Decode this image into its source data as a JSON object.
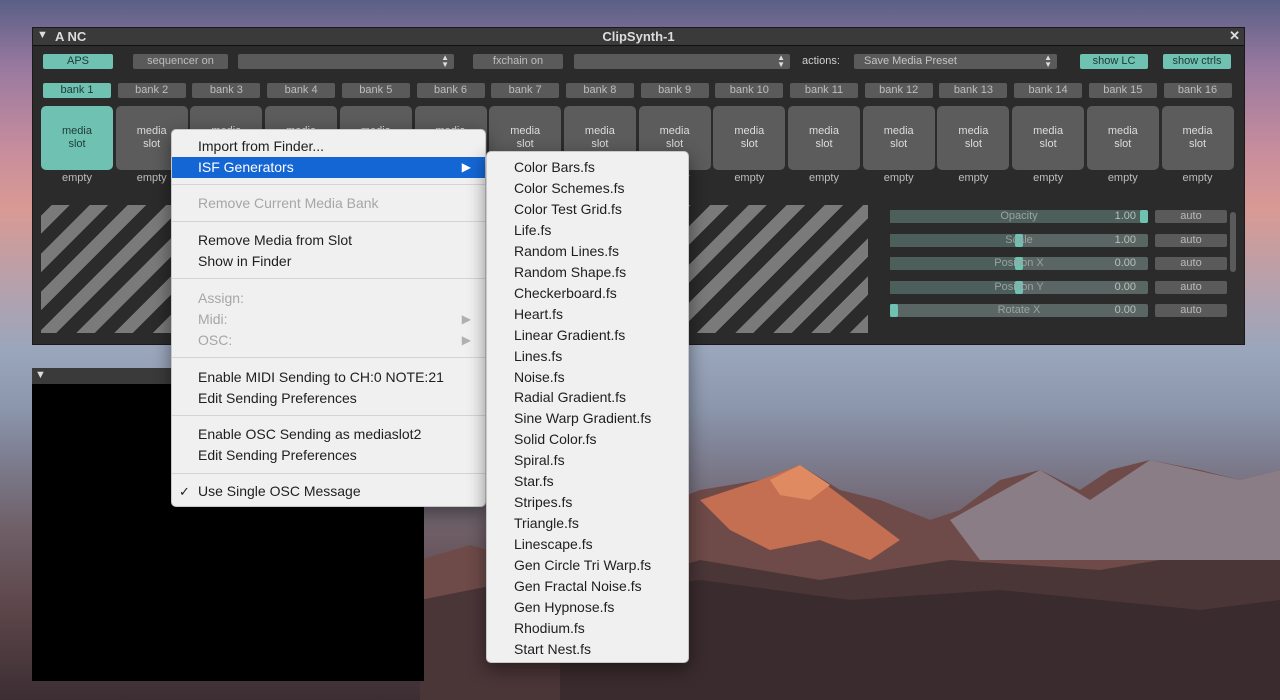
{
  "main_window": {
    "title": "ClipSynth-1",
    "left_label": "A  NC",
    "close_glyph": "✕",
    "toolbar": {
      "aps": "APS",
      "sequencer": "sequencer on",
      "fxchain": "fxchain on",
      "actions_label": "actions:",
      "actions_value": "Save Media Preset",
      "show_lc": "show LC",
      "show_ctrls": "show ctrls"
    },
    "banks": [
      "bank 1",
      "bank 2",
      "bank 3",
      "bank 4",
      "bank 5",
      "bank 6",
      "bank 7",
      "bank 8",
      "bank 9",
      "bank 10",
      "bank 11",
      "bank 12",
      "bank 13",
      "bank 14",
      "bank 15",
      "bank 16"
    ],
    "slot_label": "media slot",
    "slot_status": "empty",
    "params": [
      {
        "name": "Opacity",
        "value": "1.00",
        "auto": "auto",
        "level": 1.0
      },
      {
        "name": "Scale",
        "value": "1.00",
        "auto": "auto",
        "level": 0.5
      },
      {
        "name": "Position X",
        "value": "0.00",
        "auto": "auto",
        "level": 0.5
      },
      {
        "name": "Position Y",
        "value": "0.00",
        "auto": "auto",
        "level": 0.5
      },
      {
        "name": "Rotate X",
        "value": "0.00",
        "auto": "auto",
        "level": 0.0
      }
    ]
  },
  "context_menu": {
    "import": "Import from Finder...",
    "isf": "ISF Generators",
    "remove_bank": "Remove Current Media Bank",
    "remove_media": "Remove Media from Slot",
    "show_finder": "Show in Finder",
    "assign": "Assign:",
    "midi": "Midi:",
    "osc": "OSC:",
    "enable_midi": "Enable MIDI Sending to CH:0 NOTE:21",
    "edit_prefs_1": "Edit Sending Preferences",
    "enable_osc": "Enable OSC Sending as mediaslot2",
    "edit_prefs_2": "Edit Sending Preferences",
    "single_osc": "Use Single OSC Message",
    "check": "✓",
    "submenu_arrow": "▶"
  },
  "isf_generators": [
    "Color Bars.fs",
    "Color Schemes.fs",
    "Color Test Grid.fs",
    "Life.fs",
    "Random Lines.fs",
    "Random Shape.fs",
    "Checkerboard.fs",
    "Heart.fs",
    "Linear Gradient.fs",
    "Lines.fs",
    "Noise.fs",
    "Radial Gradient.fs",
    "Sine Warp Gradient.fs",
    "Solid Color.fs",
    "Spiral.fs",
    "Star.fs",
    "Stripes.fs",
    "Triangle.fs",
    "Linescape.fs",
    "Gen Circle Tri Warp.fs",
    "Gen Fractal Noise.fs",
    "Gen Hypnose.fs",
    "Rhodium.fs",
    "Start Nest.fs"
  ],
  "colors": {
    "accent": "#6fc2b2",
    "highlight": "#1566d5",
    "panel": "#2b2b2b"
  }
}
